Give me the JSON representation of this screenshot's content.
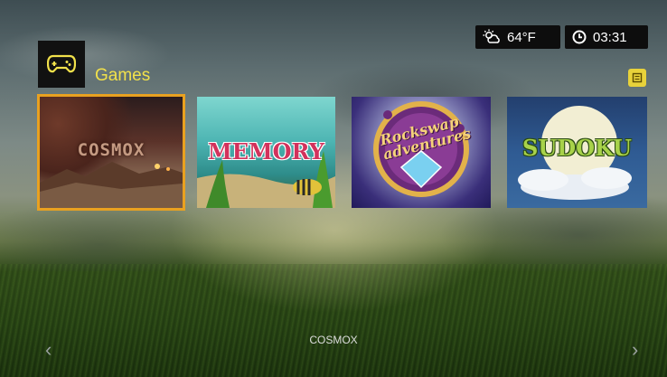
{
  "status": {
    "weather_icon": "partly-cloudy-icon",
    "temperature": "64°F",
    "clock_icon": "clock-icon",
    "time": "03:31"
  },
  "category": {
    "icon": "gamepad-icon",
    "title": "Games",
    "menu_icon": "menu-icon"
  },
  "tiles": [
    {
      "title": "COSMOX",
      "selected": true
    },
    {
      "title": "MEMORY",
      "selected": false
    },
    {
      "title": "Rockswap adventures",
      "selected": false
    },
    {
      "title": "SUDOKU",
      "selected": false
    }
  ],
  "selected_label": "COSMOX",
  "colors": {
    "accent_yellow": "#f1e14b",
    "selection_orange": "#e9a120"
  }
}
